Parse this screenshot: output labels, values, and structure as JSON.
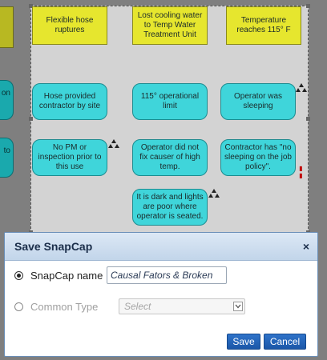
{
  "background_nodes": {
    "left_cyan_1": "on",
    "left_cyan_2": "to"
  },
  "diagram": {
    "nodes": [
      {
        "id": "n1",
        "text": "Flexible hose ruptures"
      },
      {
        "id": "n2",
        "text": "Lost cooling water to Temp Water Treatment Unit"
      },
      {
        "id": "n3",
        "text": "Temperature reaches 115° F"
      },
      {
        "id": "n4",
        "text": "Hose provided contractor by site"
      },
      {
        "id": "n5",
        "text": "115° operational limit"
      },
      {
        "id": "n6",
        "text": "Operator was sleeping"
      },
      {
        "id": "n7",
        "text": "No PM or inspection prior to this use"
      },
      {
        "id": "n8",
        "text": "Operator did not fix causer of high temp."
      },
      {
        "id": "n9",
        "text": "Contractor has \"no sleeping on the job policy\"."
      },
      {
        "id": "n10",
        "text": "It is dark and lights are poor where operator is seated."
      }
    ]
  },
  "dialog": {
    "title": "Save SnapCap",
    "close_symbol": "×",
    "snapcap_name_label": "SnapCap name",
    "snapcap_name_value": "Causal Fators & Broken",
    "common_type_label": "Common Type",
    "common_type_selected": "Select",
    "save_label": "Save",
    "cancel_label": "Cancel"
  },
  "icons": {
    "warning_triangles": "triangle-cluster-icon",
    "close": "close-icon",
    "dropdown": "chevron-down-icon"
  },
  "colors": {
    "yellow_node": "#e6e62e",
    "cyan_node": "#3fd5da",
    "dialog_header": "#c2d5ea",
    "button": "#1b57a8"
  }
}
